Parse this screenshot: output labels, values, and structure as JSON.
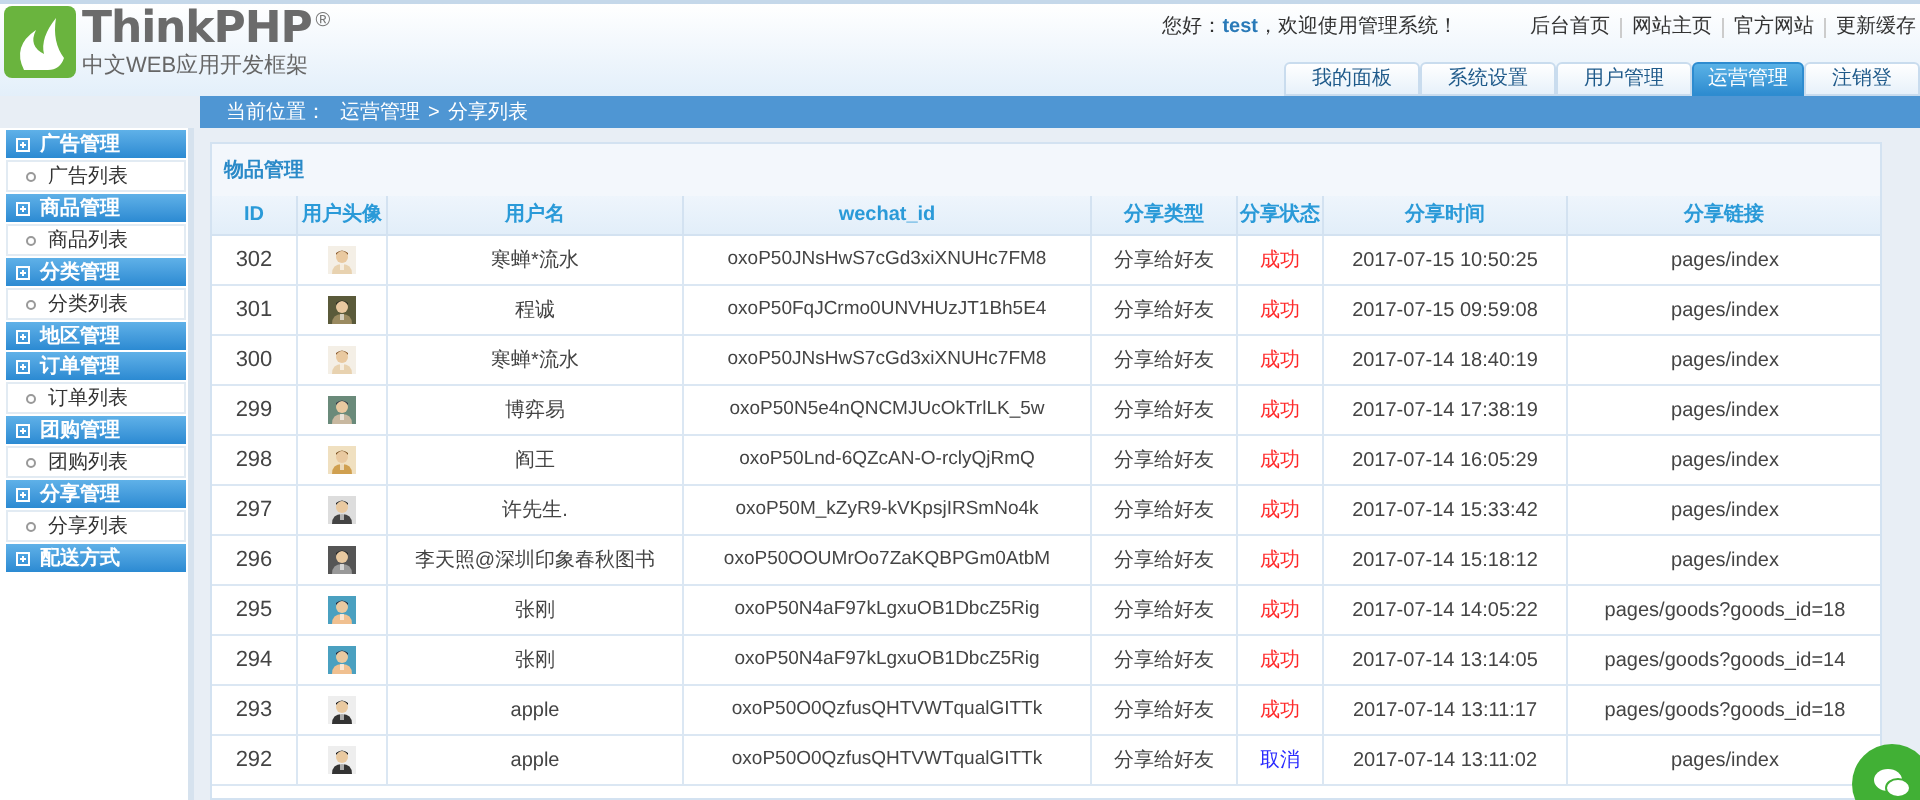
{
  "logo": {
    "name": "ThinkPHP",
    "mark": "®",
    "tagline": "中文WEB应用开发框架"
  },
  "greeting": {
    "prefix": "您好：",
    "user": "test",
    "suffix": "，欢迎使用管理系统！"
  },
  "top_links": [
    "后台首页",
    "网站主页",
    "官方网站",
    "更新缓存"
  ],
  "tabs": [
    {
      "label": "我的面板",
      "selected": false
    },
    {
      "label": "系统设置",
      "selected": false
    },
    {
      "label": "用户管理",
      "selected": false
    },
    {
      "label": "运营管理",
      "selected": true
    },
    {
      "label": "注销登",
      "selected": false
    }
  ],
  "breadcrumb": {
    "label": "当前位置：",
    "path": [
      "运营管理",
      "分享列表"
    ],
    "separator": ">"
  },
  "sidebar": [
    {
      "title": "广告管理",
      "items": [
        "广告列表"
      ]
    },
    {
      "title": "商品管理",
      "items": [
        "商品列表"
      ]
    },
    {
      "title": "分类管理",
      "items": [
        "分类列表"
      ]
    },
    {
      "title": "地区管理"
    },
    {
      "title": "订单管理",
      "items": [
        "订单列表"
      ]
    },
    {
      "title": "团购管理",
      "items": [
        "团购列表"
      ]
    },
    {
      "title": "分享管理",
      "items": [
        "分享列表"
      ]
    },
    {
      "title": "配送方式"
    }
  ],
  "panel": {
    "title": "物品管理"
  },
  "table": {
    "columns": [
      "ID",
      "用户头像",
      "用户名",
      "wechat_id",
      "分享类型",
      "分享状态",
      "分享时间",
      "分享链接"
    ],
    "rows": [
      {
        "id": "302",
        "name": "寒蝉*流水",
        "wechat_id": "oxoP50JNsHwS7cGd3xiXNUHc7FM8",
        "type": "分享给好友",
        "status": "成功",
        "color": "#ff2a2a",
        "time": "2017-07-15 10:50:25",
        "link": "pages/index"
      },
      {
        "id": "301",
        "name": "程诚",
        "wechat_id": "oxoP50FqJCrmo0UNVHUzJT1Bh5E4",
        "type": "分享给好友",
        "status": "成功",
        "color": "#ff2a2a",
        "time": "2017-07-15 09:59:08",
        "link": "pages/index"
      },
      {
        "id": "300",
        "name": "寒蝉*流水",
        "wechat_id": "oxoP50JNsHwS7cGd3xiXNUHc7FM8",
        "type": "分享给好友",
        "status": "成功",
        "color": "#ff2a2a",
        "time": "2017-07-14 18:40:19",
        "link": "pages/index"
      },
      {
        "id": "299",
        "name": "博弈易",
        "wechat_id": "oxoP50N5e4nQNCMJUcOkTrlLK_5w",
        "type": "分享给好友",
        "status": "成功",
        "color": "#ff2a2a",
        "time": "2017-07-14 17:38:19",
        "link": "pages/index"
      },
      {
        "id": "298",
        "name": "阎王",
        "wechat_id": "oxoP50Lnd-6QZcAN-O-rclyQjRmQ",
        "type": "分享给好友",
        "status": "成功",
        "color": "#ff2a2a",
        "time": "2017-07-14 16:05:29",
        "link": "pages/index"
      },
      {
        "id": "297",
        "name": "许先生.",
        "wechat_id": "oxoP50M_kZyR9-kVKpsjIRSmNo4k",
        "type": "分享给好友",
        "status": "成功",
        "color": "#ff2a2a",
        "time": "2017-07-14 15:33:42",
        "link": "pages/index"
      },
      {
        "id": "296",
        "name": "李天照@深圳印象春秋图书",
        "wechat_id": "oxoP50OOUMrOo7ZaKQBPGm0AtbM",
        "type": "分享给好友",
        "status": "成功",
        "color": "#ff2a2a",
        "time": "2017-07-14 15:18:12",
        "link": "pages/index"
      },
      {
        "id": "295",
        "name": "张刚",
        "wechat_id": "oxoP50N4aF97kLgxuOB1DbcZ5Rig",
        "type": "分享给好友",
        "status": "成功",
        "color": "#ff2a2a",
        "time": "2017-07-14 14:05:22",
        "link": "pages/goods?goods_id=18"
      },
      {
        "id": "294",
        "name": "张刚",
        "wechat_id": "oxoP50N4aF97kLgxuOB1DbcZ5Rig",
        "type": "分享给好友",
        "status": "成功",
        "color": "#ff2a2a",
        "time": "2017-07-14 13:14:05",
        "link": "pages/goods?goods_id=14"
      },
      {
        "id": "293",
        "name": "apple",
        "wechat_id": "oxoP50O0QzfusQHTVWTqualGITTk",
        "type": "分享给好友",
        "status": "成功",
        "color": "#ff2a2a",
        "time": "2017-07-14 13:11:17",
        "link": "pages/goods?goods_id=18"
      },
      {
        "id": "292",
        "name": "apple",
        "wechat_id": "oxoP50O0QzfusQHTVWTqualGITTk",
        "type": "分享给好友",
        "status": "取消",
        "color": "#2a2aff",
        "time": "2017-07-14 13:11:02",
        "link": "pages/index"
      }
    ]
  }
}
